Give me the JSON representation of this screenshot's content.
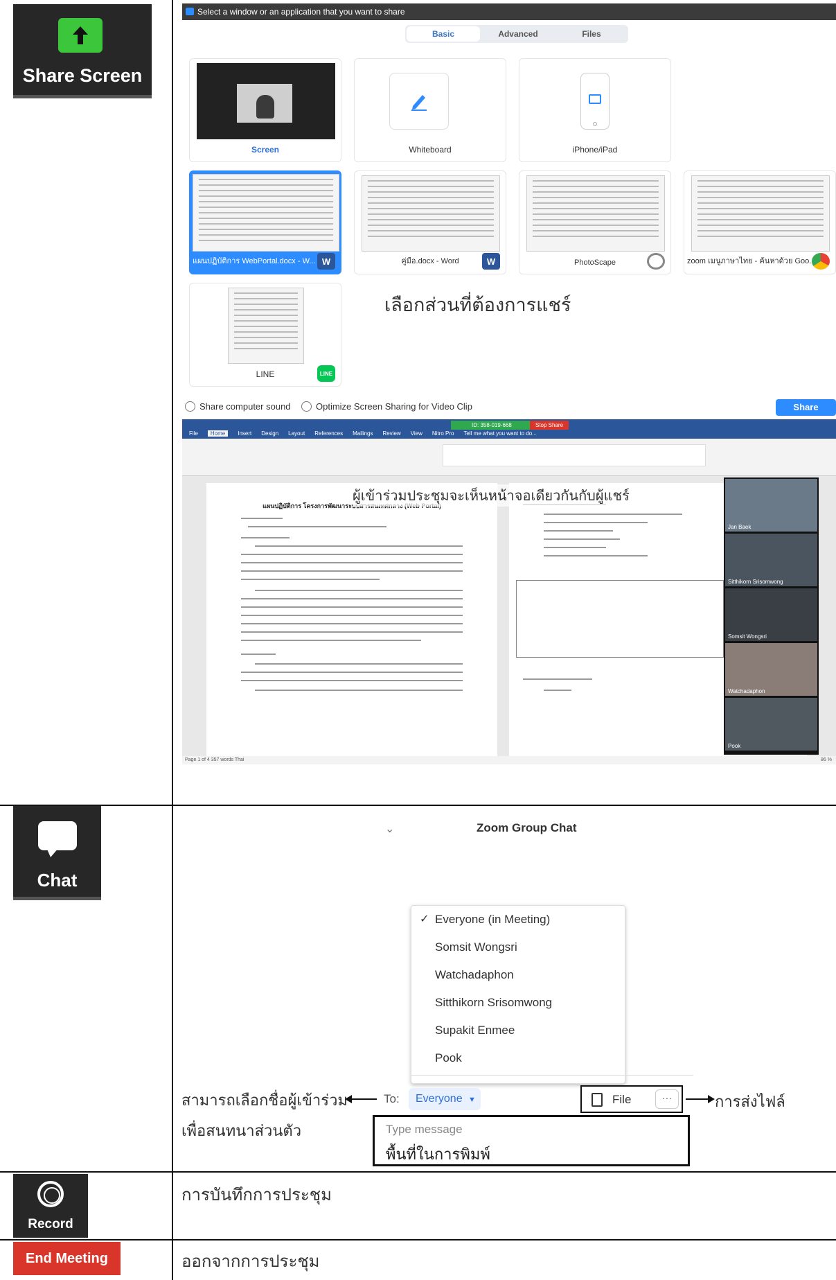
{
  "share_screen": {
    "button_label": "Share Screen",
    "window_title": "Select a window or an application that you want to share",
    "tabs": [
      "Basic",
      "Advanced",
      "Files"
    ],
    "tiles": [
      {
        "caption": "Screen"
      },
      {
        "caption": "Whiteboard"
      },
      {
        "caption": "iPhone/iPad"
      },
      {
        "caption": "แผนปฏิบัติการ WebPortal.docx - W..."
      },
      {
        "caption": "คู่มือ.docx - Word"
      },
      {
        "caption": "PhotoScape"
      },
      {
        "caption": "zoom เมนูภาษาไทย - ค้นหาด้วย Goo..."
      },
      {
        "caption": "LINE"
      }
    ],
    "annotation_select": "เลือกส่วนที่ต้องการแชร์",
    "option_sound": "Share computer sound",
    "option_optimize": "Optimize Screen Sharing for Video Clip",
    "share_button": "Share",
    "annotation_same_screen": "ผู้เข้าร่วมประชุมจะเห็นหน้าจอเดียวกันกับผู้แชร์",
    "word": {
      "meeting_id": "ID: 358-019-668",
      "stop_share": "Stop Share",
      "ribbon_tabs": [
        "File",
        "Home",
        "Insert",
        "Design",
        "Layout",
        "References",
        "Mailings",
        "Review",
        "View",
        "Nitro Pro"
      ],
      "tell_me": "Tell me what you want to do...",
      "doc_title": "แผนปฏิบัติการ โครงการพัฒนาระบบสารสนเทศกลาง (Web Portal)",
      "gallery_names": [
        "Jan Baek",
        "Sitthikorn Srisomwong",
        "Somsit Wongsri",
        "Watchadaphon",
        "Pook"
      ],
      "status": "Page 1 of 4   357 words   Thai",
      "zoom_level": "86 %"
    }
  },
  "chat": {
    "button_label": "Chat",
    "header": "Zoom Group Chat",
    "recipients": [
      "Everyone (in Meeting)",
      "Somsit Wongsri",
      "Watchadaphon",
      "Sitthikorn Srisomwong",
      "Supakit Enmee",
      "Pook"
    ],
    "selected_index": 0,
    "to_label": "To:",
    "to_value": "Everyone",
    "file_label": "File",
    "more_label": "···",
    "placeholder": "Type message",
    "annotation_typing": "พื้นที่ในการพิมพ์",
    "annotation_private_1": "สามารถเลือกชื่อผู้เข้าร่วม",
    "annotation_private_2": "เพื่อสนทนาส่วนตัว",
    "annotation_file": "การส่งไฟล์"
  },
  "record": {
    "button_label": "Record",
    "description": "การบันทึกการประชุม"
  },
  "end_meeting": {
    "button_label": "End Meeting",
    "description": "ออกจากการประชุม"
  },
  "colors": {
    "zoom_blue": "#2d8cff",
    "share_green": "#3cc63c",
    "end_red": "#d9352a",
    "dark_button": "#272727"
  }
}
